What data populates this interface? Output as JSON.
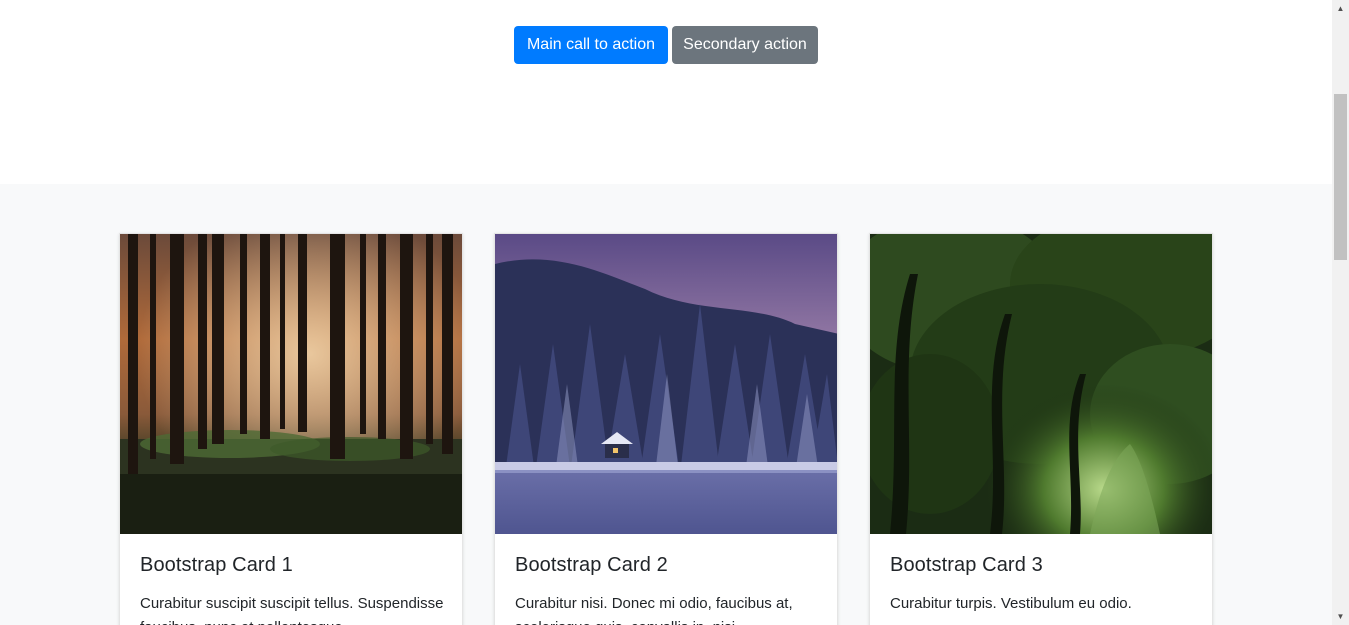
{
  "hero": {
    "primary_button": "Main call to action",
    "secondary_button": "Secondary action"
  },
  "cards": [
    {
      "title": "Bootstrap Card 1",
      "text": "Curabitur suscipit suscipit tellus. Suspendisse faucibus, nunc et pellentesque",
      "image": "forest-autumn-image"
    },
    {
      "title": "Bootstrap Card 2",
      "text": "Curabitur nisi. Donec mi odio, faucibus at, scelerisque quis, convallis in, nisi.",
      "image": "snowy-forest-cabin-image"
    },
    {
      "title": "Bootstrap Card 3",
      "text": "Curabitur turpis. Vestibulum eu odio.",
      "image": "green-forest-tunnel-image"
    }
  ],
  "colors": {
    "primary": "#007bff",
    "secondary": "#6c757d",
    "album_background": "#f8f9fa"
  }
}
